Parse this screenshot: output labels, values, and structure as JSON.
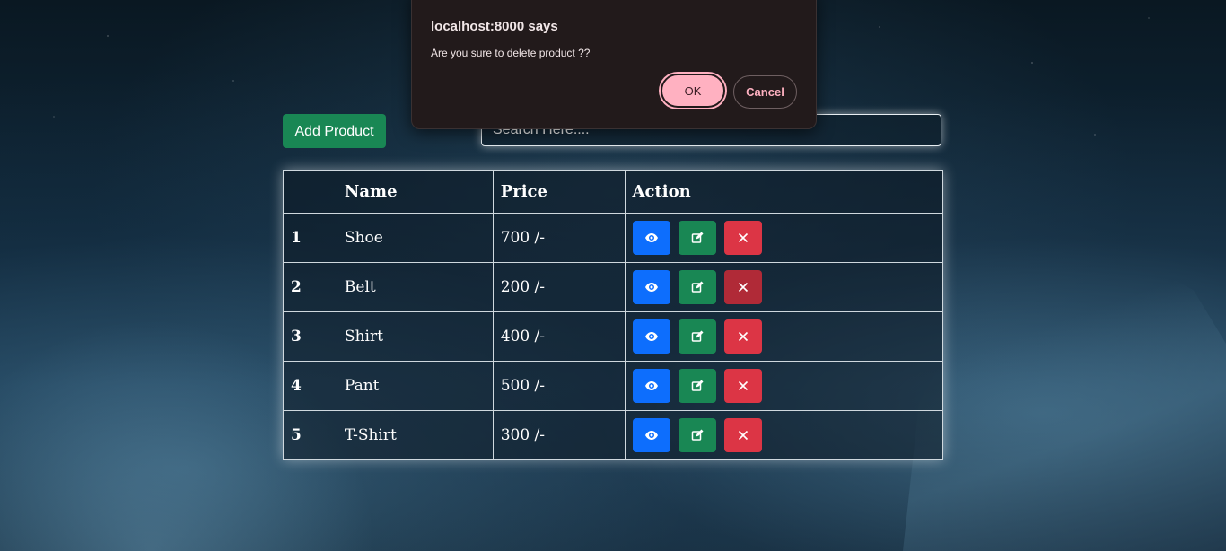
{
  "toolbar": {
    "add_label": "Add Product",
    "search_placeholder": "Search Here...."
  },
  "table": {
    "headers": [
      "",
      "Name",
      "Price",
      "Action"
    ],
    "rows": [
      {
        "index": "1",
        "name": "Shoe",
        "price": "700 /-"
      },
      {
        "index": "2",
        "name": "Belt",
        "price": "200 /-"
      },
      {
        "index": "3",
        "name": "Shirt",
        "price": "400 /-"
      },
      {
        "index": "4",
        "name": "Pant",
        "price": "500 /-"
      },
      {
        "index": "5",
        "name": "T-Shirt",
        "price": "300 /-"
      }
    ],
    "actions": [
      "eye-icon",
      "edit-icon",
      "close-icon"
    ]
  },
  "dialog": {
    "title": "localhost:8000 says",
    "message": "Are you sure to delete product ??",
    "ok_label": "OK",
    "cancel_label": "Cancel"
  },
  "colors": {
    "view": "#0d6efd",
    "edit": "#198754",
    "delete": "#dc3545",
    "ok_bg": "#ffb1c1",
    "dialog_bg": "#221a1b"
  }
}
